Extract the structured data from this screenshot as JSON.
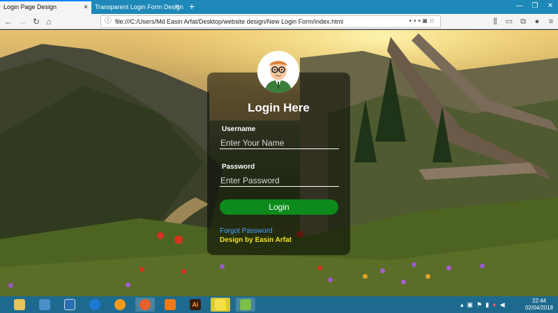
{
  "browser": {
    "tabs": [
      {
        "title": "Login Page Design",
        "active": true
      },
      {
        "title": "Transparent Login Form Design",
        "active": false
      }
    ],
    "url": "file:///C:/Users/Md Easin Arfat/Desktop/website design/New Login Form/index.html",
    "new_tab_glyph": "+",
    "close_glyph": "×"
  },
  "login": {
    "title": "Login Here",
    "username_label": "Username",
    "username_placeholder": "Enter Your Name",
    "password_label": "Password",
    "password_placeholder": "Enter Password",
    "button_label": "Login",
    "forgot_link": "Forgot Password",
    "credit": "Design by Easin Arfat"
  },
  "taskbar": {
    "apps": [
      "file-explorer-icon",
      "control-panel-icon",
      "screen-icon",
      "share-icon",
      "vlc-icon",
      "firefox-icon",
      "uc-browser-icon",
      "illustrator-icon",
      "photo-icon",
      "chart-app-icon"
    ],
    "clock_time": "22:44",
    "clock_date": "02/04/2018"
  },
  "colors": {
    "accent": "#1e88b8",
    "login_button": "#0c8a1c",
    "forgot_link": "#4aa3ff",
    "credit": "#f2e21a",
    "taskbar": "#1e6a8e"
  }
}
